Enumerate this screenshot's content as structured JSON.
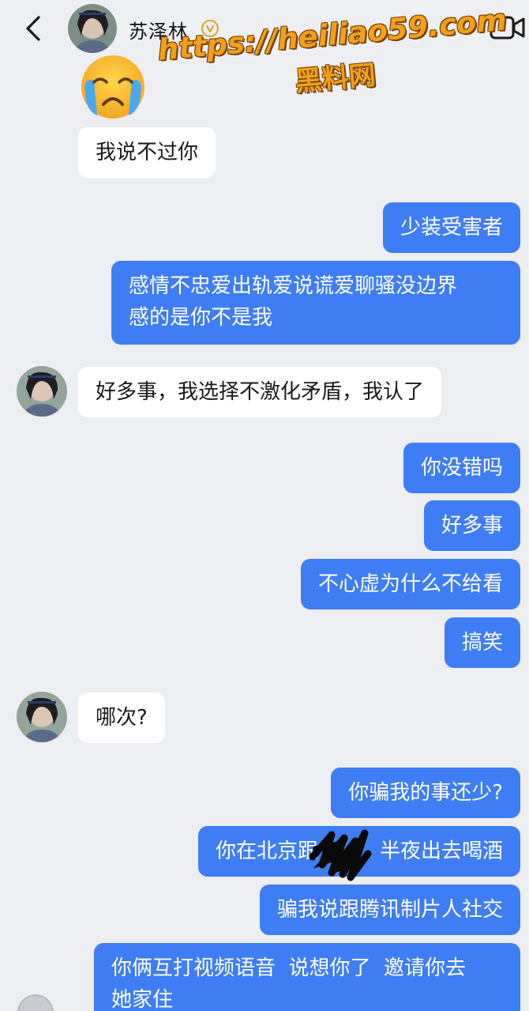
{
  "header": {
    "contact_name": "苏泽林",
    "verified_mark": "V"
  },
  "watermark": {
    "url": "https://heiliao59.com",
    "site_name": "黑料网"
  },
  "messages": [
    {
      "sender": "them",
      "text": "我说不过你"
    },
    {
      "sender": "me",
      "text": "少装受害者"
    },
    {
      "sender": "me",
      "text_line1": "感情不忠爱出轨爱说谎爱聊骚没边界",
      "text_line2": "感的是你不是我"
    },
    {
      "sender": "them",
      "text": "好多事，我选择不激化矛盾，我认了"
    },
    {
      "sender": "me",
      "text": "你没错吗"
    },
    {
      "sender": "me",
      "text": "好多事"
    },
    {
      "sender": "me",
      "text": "不心虚为什么不给看"
    },
    {
      "sender": "me",
      "text": "搞笑"
    },
    {
      "sender": "them",
      "text": "哪次?"
    },
    {
      "sender": "me",
      "text": "你骗我的事还少?"
    },
    {
      "sender": "me",
      "text": "你在北京跟　　　半夜出去喝酒"
    },
    {
      "sender": "me",
      "text": "骗我说跟腾讯制片人社交"
    },
    {
      "sender": "me",
      "text_line1": "你俩互打视频语音  说想你了  邀请你去",
      "text_line2": "她家住"
    }
  ],
  "colors": {
    "background": "#edeef2",
    "outgoing_bubble": "#3f7df5",
    "incoming_bubble": "#ffffff",
    "watermark": "#f0a11c",
    "verified": "#d9a52b"
  },
  "icons": [
    "back-arrow-icon",
    "verified-badge-icon",
    "video-call-icon",
    "crying-emoji-icon"
  ]
}
